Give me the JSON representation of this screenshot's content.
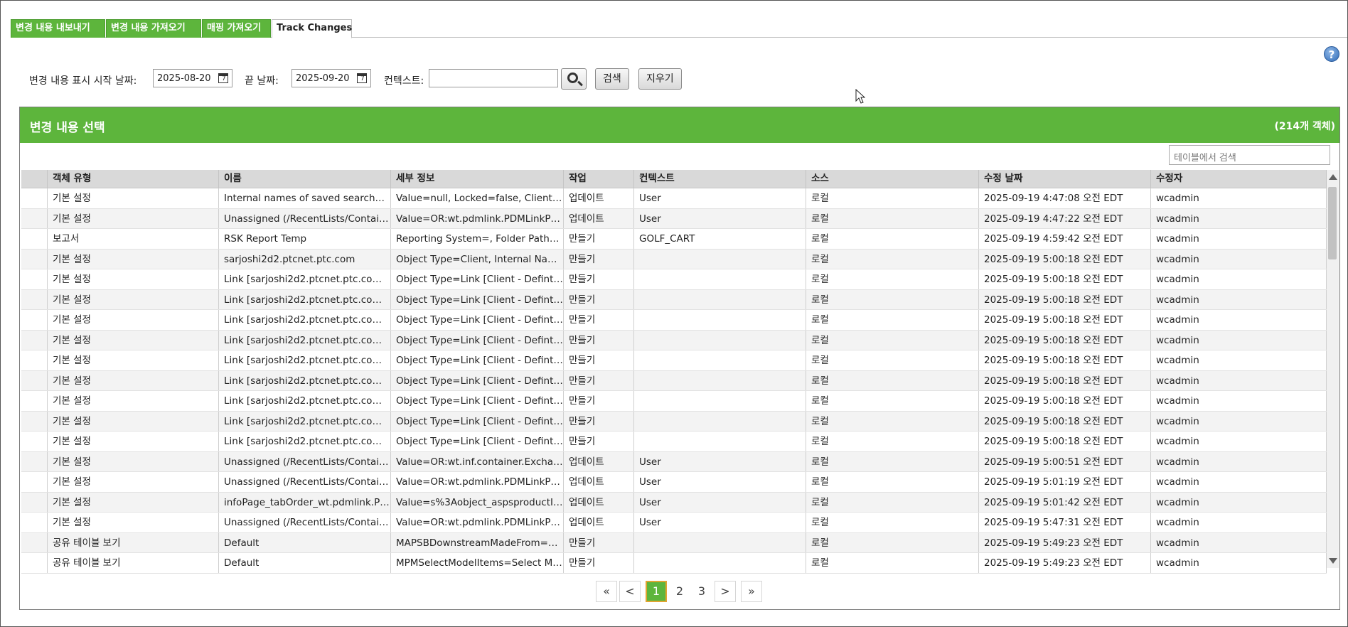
{
  "tabs": [
    "변경 내용 내보내기",
    "변경 내용 가져오기",
    "매핑 가져오기",
    "Track Changes"
  ],
  "help_icon": "?",
  "filters": {
    "start_label": "변경 내용 표시 시작 날짜:",
    "start_value": "2025-08-20",
    "end_label": "끝 날짜:",
    "end_value": "2025-09-20",
    "context_label": "컨텍스트:",
    "context_value": "",
    "search_label": "검색",
    "clear_label": "지우기"
  },
  "panel": {
    "title": "변경 내용 선택",
    "count": "(214개 객체)",
    "table_search_placeholder": "테이블에서 검색"
  },
  "columns": [
    "",
    "객체 유형",
    "이름",
    "세부 정보",
    "작업",
    "컨텍스트",
    "소스",
    "수정 날짜",
    "수정자"
  ],
  "rows": [
    [
      "",
      "기본 설정",
      "Internal names of saved searches f...",
      "Value=null, Locked=false, Client=...",
      "업데이트",
      "User",
      "로컬",
      "2025-09-19 4:47:08 오전 EDT",
      "wcadmin"
    ],
    [
      "",
      "기본 설정",
      "Unassigned (/RecentLists/Contain...",
      "Value=OR:wt.pdmlink.PDMLinkPro...",
      "업데이트",
      "User",
      "로컬",
      "2025-09-19 4:47:22 오전 EDT",
      "wcadmin"
    ],
    [
      "",
      "보고서",
      "RSK Report Temp",
      "Reporting System=, Folder Path=n...",
      "만들기",
      "GOLF_CART",
      "로컬",
      "2025-09-19 4:59:42 오전 EDT",
      "wcadmin"
    ],
    [
      "",
      "기본 설정",
      "sarjoshi2d2.ptcnet.ptc.com",
      "Object Type=Client, Internal Name...",
      "만들기",
      "",
      "로컬",
      "2025-09-19 5:00:18 오전 EDT",
      "wcadmin"
    ],
    [
      "",
      "기본 설정",
      "Link [sarjoshi2d2.ptcnet.ptc.com - ...",
      "Object Type=Link [Client - Defintio...",
      "만들기",
      "",
      "로컬",
      "2025-09-19 5:00:18 오전 EDT",
      "wcadmin"
    ],
    [
      "",
      "기본 설정",
      "Link [sarjoshi2d2.ptcnet.ptc.com - ...",
      "Object Type=Link [Client - Defintio...",
      "만들기",
      "",
      "로컬",
      "2025-09-19 5:00:18 오전 EDT",
      "wcadmin"
    ],
    [
      "",
      "기본 설정",
      "Link [sarjoshi2d2.ptcnet.ptc.com - ...",
      "Object Type=Link [Client - Defintio...",
      "만들기",
      "",
      "로컬",
      "2025-09-19 5:00:18 오전 EDT",
      "wcadmin"
    ],
    [
      "",
      "기본 설정",
      "Link [sarjoshi2d2.ptcnet.ptc.com - ...",
      "Object Type=Link [Client - Defintio...",
      "만들기",
      "",
      "로컬",
      "2025-09-19 5:00:18 오전 EDT",
      "wcadmin"
    ],
    [
      "",
      "기본 설정",
      "Link [sarjoshi2d2.ptcnet.ptc.com - ...",
      "Object Type=Link [Client - Defintio...",
      "만들기",
      "",
      "로컬",
      "2025-09-19 5:00:18 오전 EDT",
      "wcadmin"
    ],
    [
      "",
      "기본 설정",
      "Link [sarjoshi2d2.ptcnet.ptc.com - ...",
      "Object Type=Link [Client - Defintio...",
      "만들기",
      "",
      "로컬",
      "2025-09-19 5:00:18 오전 EDT",
      "wcadmin"
    ],
    [
      "",
      "기본 설정",
      "Link [sarjoshi2d2.ptcnet.ptc.com - ...",
      "Object Type=Link [Client - Defintio...",
      "만들기",
      "",
      "로컬",
      "2025-09-19 5:00:18 오전 EDT",
      "wcadmin"
    ],
    [
      "",
      "기본 설정",
      "Link [sarjoshi2d2.ptcnet.ptc.com - ...",
      "Object Type=Link [Client - Defintio...",
      "만들기",
      "",
      "로컬",
      "2025-09-19 5:00:18 오전 EDT",
      "wcadmin"
    ],
    [
      "",
      "기본 설정",
      "Link [sarjoshi2d2.ptcnet.ptc.com - ...",
      "Object Type=Link [Client - Defintio...",
      "만들기",
      "",
      "로컬",
      "2025-09-19 5:00:18 오전 EDT",
      "wcadmin"
    ],
    [
      "",
      "기본 설정",
      "Unassigned (/RecentLists/Contain...",
      "Value=OR:wt.inf.container.Exchan...",
      "업데이트",
      "User",
      "로컬",
      "2025-09-19 5:00:51 오전 EDT",
      "wcadmin"
    ],
    [
      "",
      "기본 설정",
      "Unassigned (/RecentLists/Contain...",
      "Value=OR:wt.pdmlink.PDMLinkPro...",
      "업데이트",
      "User",
      "로컬",
      "2025-09-19 5:01:19 오전 EDT",
      "wcadmin"
    ],
    [
      "",
      "기본 설정",
      "infoPage_tabOrder_wt.pdmlink.PD...",
      "Value=s%3Aobject_aspsproductInf...",
      "업데이트",
      "User",
      "로컬",
      "2025-09-19 5:01:42 오전 EDT",
      "wcadmin"
    ],
    [
      "",
      "기본 설정",
      "Unassigned (/RecentLists/Contain...",
      "Value=OR:wt.pdmlink.PDMLinkPro...",
      "업데이트",
      "User",
      "로컬",
      "2025-09-19 5:47:31 오전 EDT",
      "wcadmin"
    ],
    [
      "",
      "공유 테이블 보기",
      "Default",
      "MAPSBDownstreamMadeFrom=M...",
      "만들기",
      "",
      "로컬",
      "2025-09-19 5:49:23 오전 EDT",
      "wcadmin"
    ],
    [
      "",
      "공유 테이블 보기",
      "Default",
      "MPMSelectModelItems=Select Mo...",
      "만들기",
      "",
      "로컬",
      "2025-09-19 5:49:23 오전 EDT",
      "wcadmin"
    ]
  ],
  "pager": {
    "first": "«",
    "prev": "<",
    "pages": [
      "1",
      "2",
      "3"
    ],
    "current": "1",
    "next": ">",
    "last": "»"
  },
  "colors": {
    "accent_green": "#5db53c",
    "current_page_border": "#e0a431"
  }
}
